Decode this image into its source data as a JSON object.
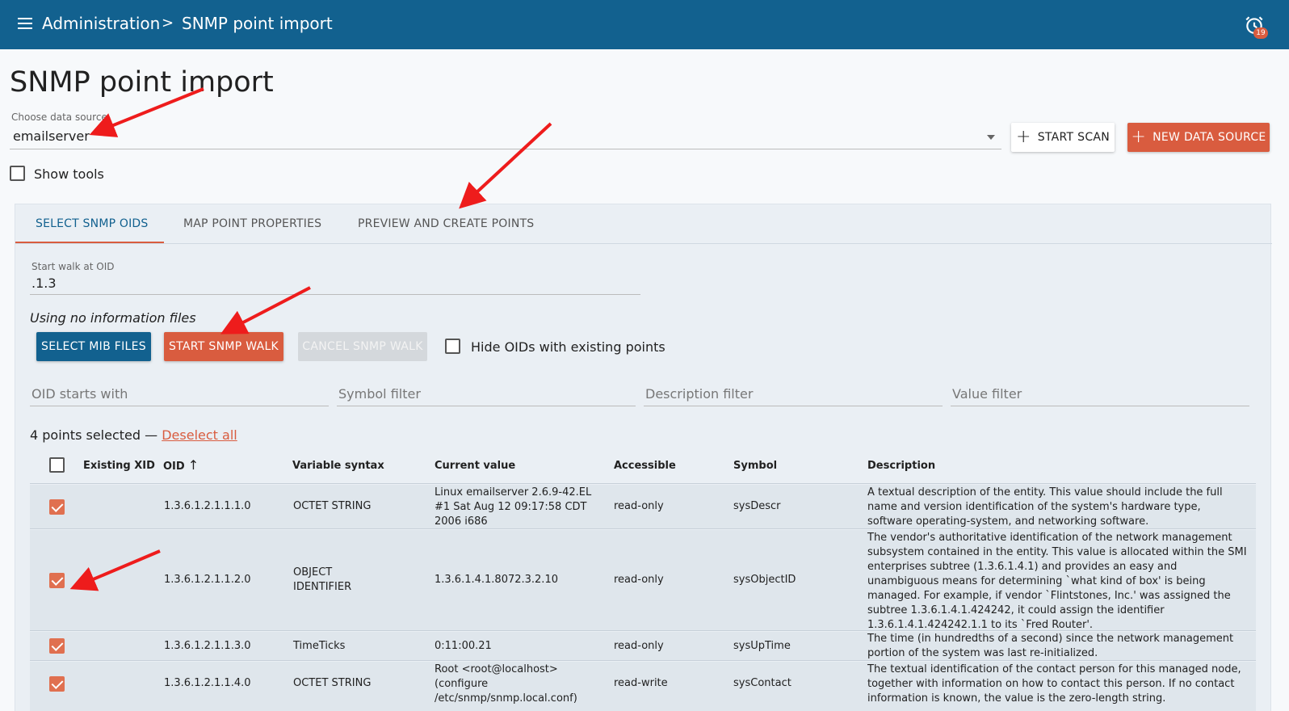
{
  "header": {
    "breadcrumb_parent": "Administration",
    "breadcrumb_separator": ">",
    "breadcrumb_current": "SNMP point import",
    "alarm_count": "19"
  },
  "page": {
    "title": "SNMP point import"
  },
  "data_source": {
    "label": "Choose data source",
    "value": "emailserver",
    "start_scan_label": "START SCAN",
    "new_data_source_label": "NEW DATA SOURCE"
  },
  "show_tools_label": "Show tools",
  "tabs": [
    {
      "label": "SELECT SNMP OIDS"
    },
    {
      "label": "MAP POINT PROPERTIES"
    },
    {
      "label": "PREVIEW AND CREATE POINTS"
    }
  ],
  "walk": {
    "label": "Start walk at OID",
    "value": ".1.3",
    "info_files": "Using no information files",
    "select_mib_label": "SELECT MIB FILES",
    "start_walk_label": "START SNMP WALK",
    "cancel_walk_label": "CANCEL SNMP WALK",
    "hide_existing_label": "Hide OIDs with existing points"
  },
  "filters": {
    "oid": "OID starts with",
    "symbol": "Symbol filter",
    "description": "Description filter",
    "value": "Value filter"
  },
  "selection": {
    "count_text": "4 points selected —",
    "deselect_label": "Deselect all"
  },
  "table": {
    "headers": {
      "existing_xid": "Existing XID",
      "oid": "OID",
      "syntax": "Variable syntax",
      "value": "Current value",
      "accessible": "Accessible",
      "symbol": "Symbol",
      "description": "Description"
    },
    "rows": [
      {
        "oid": "1.3.6.1.2.1.1.1.0",
        "syntax": "OCTET STRING",
        "value": "Linux emailserver 2.6.9-42.EL #1 Sat Aug 12 09:17:58 CDT 2006 i686",
        "accessible": "read-only",
        "symbol": "sysDescr",
        "description": "A textual description of the entity. This value should include the full name and version identification of the system's hardware type, software operating-system, and networking software."
      },
      {
        "oid": "1.3.6.1.2.1.1.2.0",
        "syntax": "OBJECT IDENTIFIER",
        "value": "1.3.6.1.4.1.8072.3.2.10",
        "accessible": "read-only",
        "symbol": "sysObjectID",
        "description": "The vendor's authoritative identification of the network management subsystem contained in the entity. This value is allocated within the SMI enterprises subtree (1.3.6.1.4.1) and provides an easy and unambiguous means for determining `what kind of box' is being managed. For example, if vendor `Flintstones, Inc.' was assigned the subtree 1.3.6.1.4.1.424242, it could assign the identifier 1.3.6.1.4.1.424242.1.1 to its `Fred Router'."
      },
      {
        "oid": "1.3.6.1.2.1.1.3.0",
        "syntax": "TimeTicks",
        "value": "0:11:00.21",
        "accessible": "read-only",
        "symbol": "sysUpTime",
        "description": "The time (in hundredths of a second) since the network management portion of the system was last re-initialized."
      },
      {
        "oid": "1.3.6.1.2.1.1.4.0",
        "syntax": "OCTET STRING",
        "value": "Root <root@localhost> (configure /etc/snmp/snmp.local.conf)",
        "accessible": "read-write",
        "symbol": "sysContact",
        "description": "The textual identification of the contact person for this managed node, together with information on how to contact this person. If no contact information is known, the value is the zero-length string."
      }
    ]
  }
}
